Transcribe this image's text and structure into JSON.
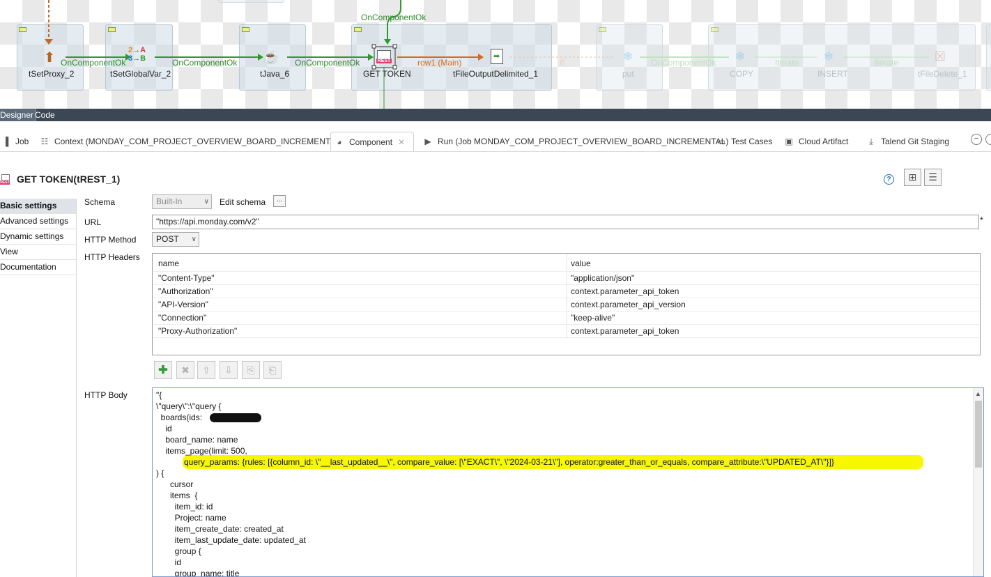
{
  "canvas": {
    "components": [
      {
        "id": "tsetproxy",
        "label": "tSetProxy_2"
      },
      {
        "id": "tsetglobalvar",
        "label": "tSetGlobalVar_2"
      },
      {
        "id": "tjava",
        "label": "tJava_6"
      },
      {
        "id": "gettoken",
        "label": "GET TOKEN",
        "badge": "REST"
      },
      {
        "id": "tfileoutput",
        "label": "tFileOutputDelimited_1"
      },
      {
        "id": "put",
        "label": "put"
      },
      {
        "id": "copy",
        "label": "COPY"
      },
      {
        "id": "insert",
        "label": "INSERT"
      },
      {
        "id": "tfiledelete",
        "label": "tFileDelete_1"
      }
    ],
    "connections": {
      "c1": "OnComponentOk",
      "c2": "OnComponentOk",
      "c3": "OnComponentOk",
      "top": "OnComponentOk",
      "row": "row1 (Main)",
      "if": "If",
      "c4": "OnComponentOk",
      "iter1": "Iterate",
      "iter2": "Iterate"
    },
    "globalvar_icon": {
      "a": "2",
      "b": "A",
      "c": "3",
      "d": "B"
    }
  },
  "editor_tabs": {
    "designer": "Designer",
    "code": "Code"
  },
  "view_tabs": [
    {
      "label": "Job",
      "icon": "job-icon"
    },
    {
      "label": "Context (MONDAY_COM_PROJECT_OVERVIEW_BOARD_INCREMENTAL)",
      "icon": "context-icon"
    },
    {
      "label": "Component",
      "icon": "component-icon",
      "active": true
    },
    {
      "label": "Run (Job MONDAY_COM_PROJECT_OVERVIEW_BOARD_INCREMENTAL)",
      "icon": "run-icon"
    },
    {
      "label": "Test Cases",
      "icon": "testcases-icon"
    },
    {
      "label": "Cloud Artifact",
      "icon": "cloud-artifact-icon"
    },
    {
      "label": "Talend Git Staging",
      "icon": "git-staging-icon"
    }
  ],
  "component": {
    "title": "GET TOKEN(tREST_1)",
    "icon_badge": "REST"
  },
  "nav": [
    "Basic settings",
    "Advanced settings",
    "Dynamic settings",
    "View",
    "Documentation"
  ],
  "form": {
    "schema_label": "Schema",
    "schema_value": "Built-In",
    "edit_schema_label": "Edit schema",
    "edit_schema_button": "...",
    "url_label": "URL",
    "url_value": "\"https://api.monday.com/v2\"",
    "url_required": "*",
    "method_label": "HTTP Method",
    "method_value": "POST",
    "headers_label": "HTTP Headers",
    "body_label": "HTTP Body"
  },
  "headers_table": {
    "columns": [
      "name",
      "value"
    ],
    "rows": [
      {
        "name": "\"Content-Type\"",
        "value": "\"application/json\""
      },
      {
        "name": "\"Authorization\"",
        "value": "context.parameter_api_token"
      },
      {
        "name": "\"API-Version\"",
        "value": "context.parameter_api_version"
      },
      {
        "name": "\"Connection\"",
        "value": "\"keep-alive\""
      },
      {
        "name": "\"Proxy-Authorization\"",
        "value": "context.parameter_api_token"
      }
    ]
  },
  "body_lines": [
    "\"{",
    "\\\"query\\\":\\\"query {",
    "  boards(ids:            ) {",
    "    id",
    "    board_name: name",
    "    items_page(limit: 500,",
    "            query_params: {rules: [{column_id: \\\"__last_updated__\\\", compare_value: [\\\"EXACT\\\", \\\"2024-03-21\\\"], operator:greater_than_or_equals, compare_attribute:\\\"UPDATED_AT\\\"}]}",
    ") {",
    "      cursor",
    "      items  {",
    "        item_id: id",
    "        Project: name",
    "        item_create_date: created_at",
    "        item_last_update_date: updated_at",
    "        group {",
    "        id",
    "        group_name: title"
  ],
  "colors": {
    "accent_bar": "#3b4754",
    "connection_green": "#2e8b2e",
    "connection_orange": "#d86a1a",
    "highlight": "#f7f700",
    "help": "#1f6fbf"
  }
}
